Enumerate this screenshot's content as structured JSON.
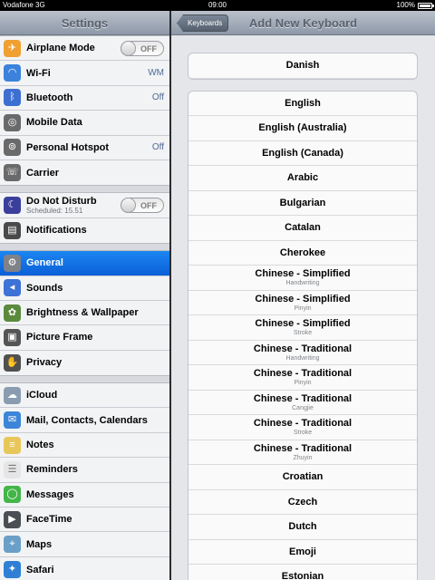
{
  "status": {
    "carrier": "Vodafone 3G",
    "time": "09:00",
    "battery": "100%",
    "battery_level": 1.0
  },
  "master": {
    "title": "Settings",
    "groups": [
      [
        {
          "label": "Airplane Mode",
          "toggle": "OFF",
          "icon": "airplane-icon",
          "color": "#f0a030"
        },
        {
          "label": "Wi-Fi",
          "value": "WM",
          "icon": "wifi-icon",
          "color": "#3c82dc"
        },
        {
          "label": "Bluetooth",
          "value": "Off",
          "icon": "bluetooth-icon",
          "color": "#3c6fd0"
        },
        {
          "label": "Mobile Data",
          "icon": "antenna-icon",
          "color": "#6a6a6a"
        },
        {
          "label": "Personal Hotspot",
          "value": "Off",
          "icon": "hotspot-icon",
          "color": "#6a6a6a"
        },
        {
          "label": "Carrier",
          "icon": "phone-icon",
          "color": "#6a6a6a"
        }
      ],
      [
        {
          "label": "Do Not Disturb",
          "sub": "Scheduled: 15.51",
          "toggle": "OFF",
          "icon": "moon-icon",
          "color": "#3b3f9c"
        },
        {
          "label": "Notifications",
          "icon": "notifications-icon",
          "color": "#4a4a4a"
        }
      ],
      [
        {
          "label": "General",
          "icon": "gear-icon",
          "color": "#7f8288",
          "selected": true
        },
        {
          "label": "Sounds",
          "icon": "speaker-icon",
          "color": "#3d72d6"
        },
        {
          "label": "Brightness & Wallpaper",
          "icon": "flower-icon",
          "color": "#5b8a3c"
        },
        {
          "label": "Picture Frame",
          "icon": "picture-frame-icon",
          "color": "#555555"
        },
        {
          "label": "Privacy",
          "icon": "hand-icon",
          "color": "#505050"
        }
      ],
      [
        {
          "label": "iCloud",
          "icon": "cloud-icon",
          "color": "#8a9db0"
        },
        {
          "label": "Mail, Contacts, Calendars",
          "icon": "mail-icon",
          "color": "#3c85d8"
        },
        {
          "label": "Notes",
          "icon": "notes-icon",
          "color": "#e8c75a"
        },
        {
          "label": "Reminders",
          "icon": "reminders-icon",
          "color": "#e6e6e6"
        },
        {
          "label": "Messages",
          "icon": "messages-icon",
          "color": "#43b649"
        },
        {
          "label": "FaceTime",
          "icon": "facetime-icon",
          "color": "#4a4f55"
        },
        {
          "label": "Maps",
          "icon": "maps-icon",
          "color": "#6aa0c8"
        },
        {
          "label": "Safari",
          "icon": "safari-icon",
          "color": "#2f7fd5"
        }
      ]
    ]
  },
  "detail": {
    "back_label": "Keyboards",
    "title": "Add New Keyboard",
    "top_item": {
      "label": "Danish"
    },
    "items": [
      {
        "label": "English"
      },
      {
        "label": "English (Australia)"
      },
      {
        "label": "English (Canada)"
      },
      {
        "label": "Arabic"
      },
      {
        "label": "Bulgarian"
      },
      {
        "label": "Catalan"
      },
      {
        "label": "Cherokee"
      },
      {
        "label": "Chinese - Simplified",
        "sub": "Handwriting"
      },
      {
        "label": "Chinese - Simplified",
        "sub": "Pinyin"
      },
      {
        "label": "Chinese - Simplified",
        "sub": "Stroke"
      },
      {
        "label": "Chinese - Traditional",
        "sub": "Handwriting"
      },
      {
        "label": "Chinese - Traditional",
        "sub": "Pinyin"
      },
      {
        "label": "Chinese - Traditional",
        "sub": "Cangjie"
      },
      {
        "label": "Chinese - Traditional",
        "sub": "Stroke"
      },
      {
        "label": "Chinese - Traditional",
        "sub": "Zhuyin"
      },
      {
        "label": "Croatian"
      },
      {
        "label": "Czech"
      },
      {
        "label": "Dutch"
      },
      {
        "label": "Emoji"
      },
      {
        "label": "Estonian"
      }
    ]
  }
}
